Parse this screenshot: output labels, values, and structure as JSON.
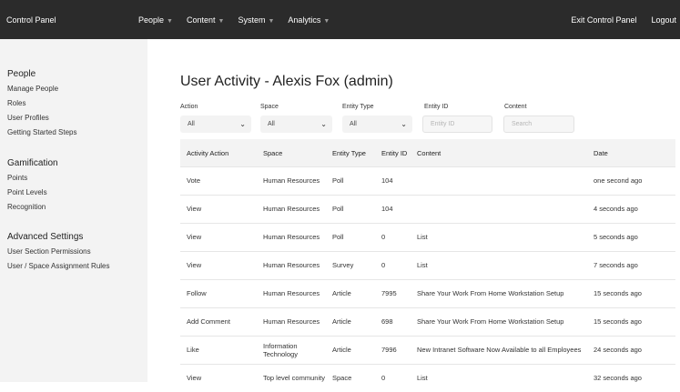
{
  "topbar": {
    "brand": "Control Panel",
    "nav": [
      "People",
      "Content",
      "System",
      "Analytics"
    ],
    "exit": "Exit Control Panel",
    "logout": "Logout"
  },
  "sidebar": {
    "people_title": "People",
    "people_items": [
      "Manage People",
      "Roles",
      "User Profiles",
      "Getting Started Steps"
    ],
    "gam_title": "Gamification",
    "gam_items": [
      "Points",
      "Point Levels",
      "Recognition"
    ],
    "adv_title": "Advanced Settings",
    "adv_items": [
      "User Section Permissions",
      "User / Space Assignment Rules"
    ]
  },
  "page": {
    "title": "User Activity - Alexis Fox (admin)"
  },
  "filters": {
    "action_label": "Action",
    "action_value": "All",
    "space_label": "Space",
    "space_value": "All",
    "type_label": "Entity Type",
    "type_value": "All",
    "id_label": "Entity ID",
    "id_placeholder": "Entity ID",
    "content_label": "Content",
    "content_placeholder": "Search"
  },
  "table": {
    "headers": [
      "Activity Action",
      "Space",
      "Entity Type",
      "Entity ID",
      "Content",
      "Date"
    ],
    "rows": [
      [
        "Vote",
        "Human Resources",
        "Poll",
        "104",
        "",
        "one second ago"
      ],
      [
        "View",
        "Human Resources",
        "Poll",
        "104",
        "",
        "4 seconds ago"
      ],
      [
        "View",
        "Human Resources",
        "Poll",
        "0",
        "List",
        "5 seconds ago"
      ],
      [
        "View",
        "Human Resources",
        "Survey",
        "0",
        "List",
        "7 seconds ago"
      ],
      [
        "Follow",
        "Human Resources",
        "Article",
        "7995",
        "Share Your Work From Home Workstation Setup",
        "15 seconds ago"
      ],
      [
        "Add Comment",
        "Human Resources",
        "Article",
        "698",
        "Share Your Work From Home Workstation Setup",
        "15 seconds ago"
      ],
      [
        "Like",
        "Information Technology",
        "Article",
        "7996",
        "New Intranet Software Now Available to all Employees",
        "24 seconds ago"
      ],
      [
        "View",
        "Top level community",
        "Space",
        "0",
        "List",
        "32 seconds ago"
      ]
    ]
  }
}
